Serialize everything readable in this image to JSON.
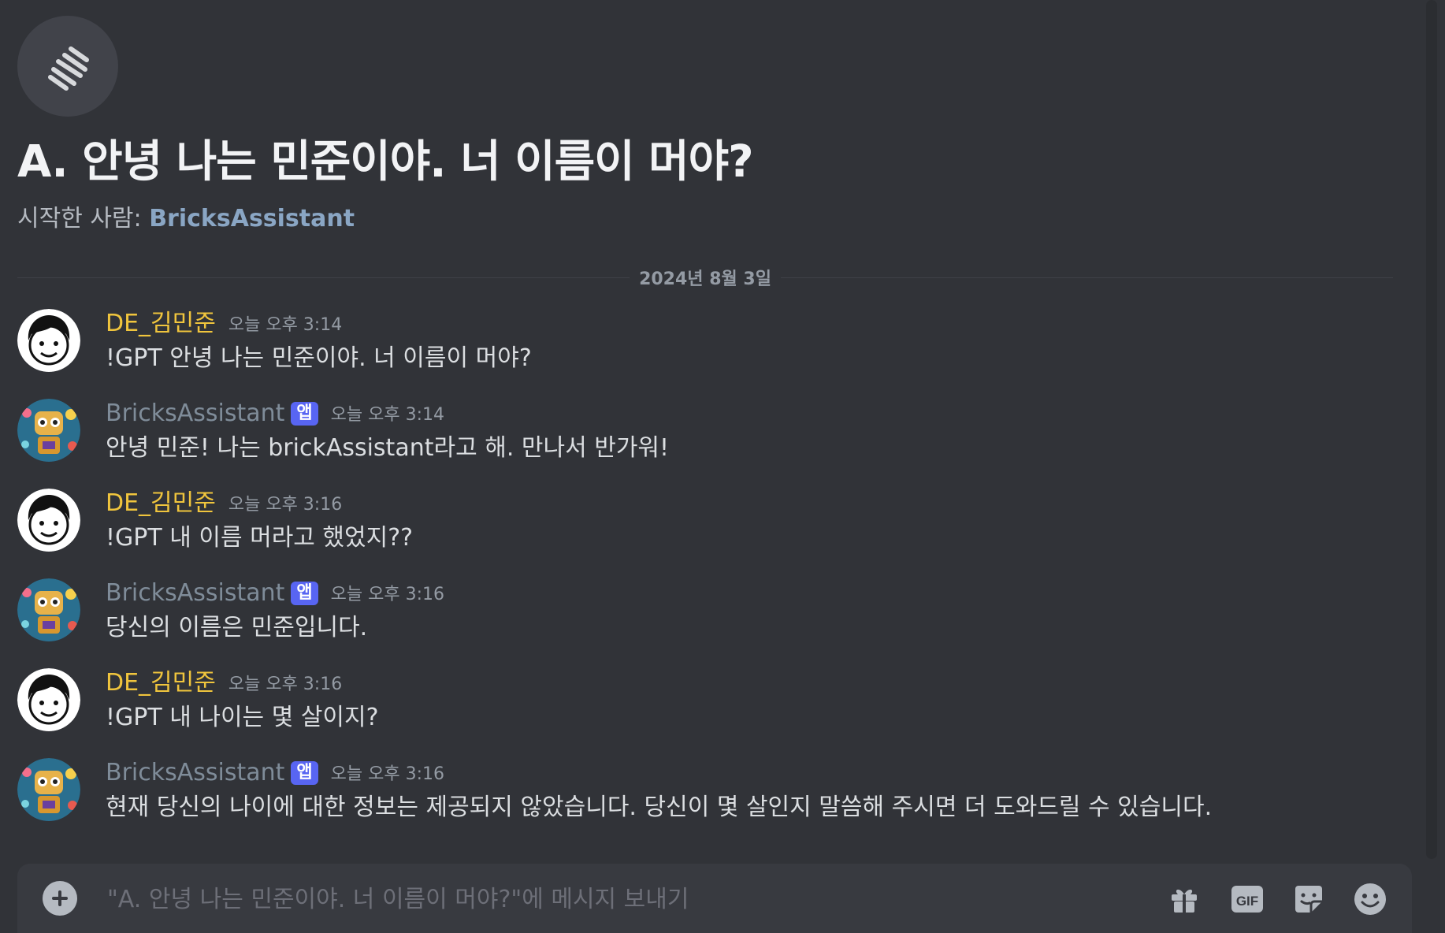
{
  "thread": {
    "icon": "thread-icon",
    "title": "A. 안녕 나는 민준이야. 너 이름이 머야?",
    "starter_prefix": "시작한 사람: ",
    "starter_name": "BricksAssistant"
  },
  "date_divider": "2024년 8월 3일",
  "messages": [
    {
      "author": "DE_김민준",
      "role": "user",
      "time": "오늘 오후 3:14",
      "text": "!GPT 안녕 나는 민준이야. 너 이름이 머야?"
    },
    {
      "author": "BricksAssistant",
      "role": "bot",
      "badge": "앱",
      "time": "오늘 오후 3:14",
      "text": "안녕 민준! 나는 brickAssistant라고 해. 만나서 반가워!"
    },
    {
      "author": "DE_김민준",
      "role": "user",
      "time": "오늘 오후 3:16",
      "text": "!GPT 내 이름 머라고 했었지??"
    },
    {
      "author": "BricksAssistant",
      "role": "bot",
      "badge": "앱",
      "time": "오늘 오후 3:16",
      "text": "당신의 이름은 민준입니다."
    },
    {
      "author": "DE_김민준",
      "role": "user",
      "time": "오늘 오후 3:16",
      "text": "!GPT 내 나이는 몇 살이지?"
    },
    {
      "author": "BricksAssistant",
      "role": "bot",
      "badge": "앱",
      "time": "오늘 오후 3:16",
      "text": "현재 당신의 나이에 대한 정보는 제공되지 않았습니다. 당신이 몇 살인지 말씀해 주시면 더 도와드릴 수 있습니다."
    }
  ],
  "composer": {
    "placeholder": "\"A. 안녕 나는 민준이야. 너 이름이 머야?\"에 메시지 보내기",
    "value": "",
    "icons": [
      "plus-icon",
      "gift-icon",
      "gif-icon",
      "sticker-icon",
      "emoji-icon"
    ],
    "gif_label": "GIF"
  },
  "colors": {
    "background": "#313338",
    "user_name": "#f0c53d",
    "bot_name": "#7f8c99",
    "app_badge": "#5865f2",
    "starter_name": "#8aa6c4"
  }
}
